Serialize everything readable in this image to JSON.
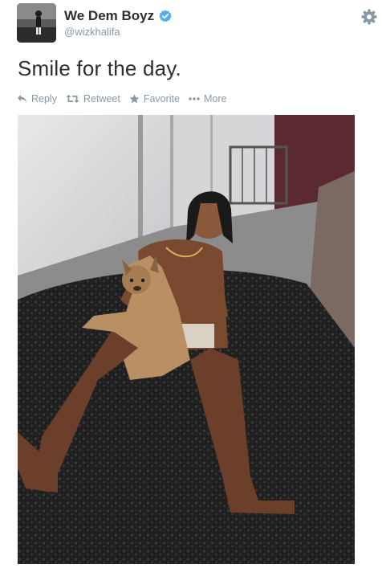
{
  "tweet": {
    "display_name": "We Dem Boyz",
    "handle": "@wizkhalifa",
    "text": "Smile for the day.",
    "verified": true
  },
  "actions": {
    "reply_label": "Reply",
    "retweet_label": "Retweet",
    "favorite_label": "Favorite",
    "more_label": "More"
  },
  "icons": {
    "verified": "verified-badge-icon",
    "settings": "gear-icon",
    "reply": "reply-arrow-icon",
    "retweet": "retweet-icon",
    "favorite": "star-icon",
    "more": "ellipsis-icon"
  },
  "colors": {
    "name": "#292f33",
    "meta": "#8899a6",
    "verified": "#55acee",
    "icon": "#8899a6"
  }
}
